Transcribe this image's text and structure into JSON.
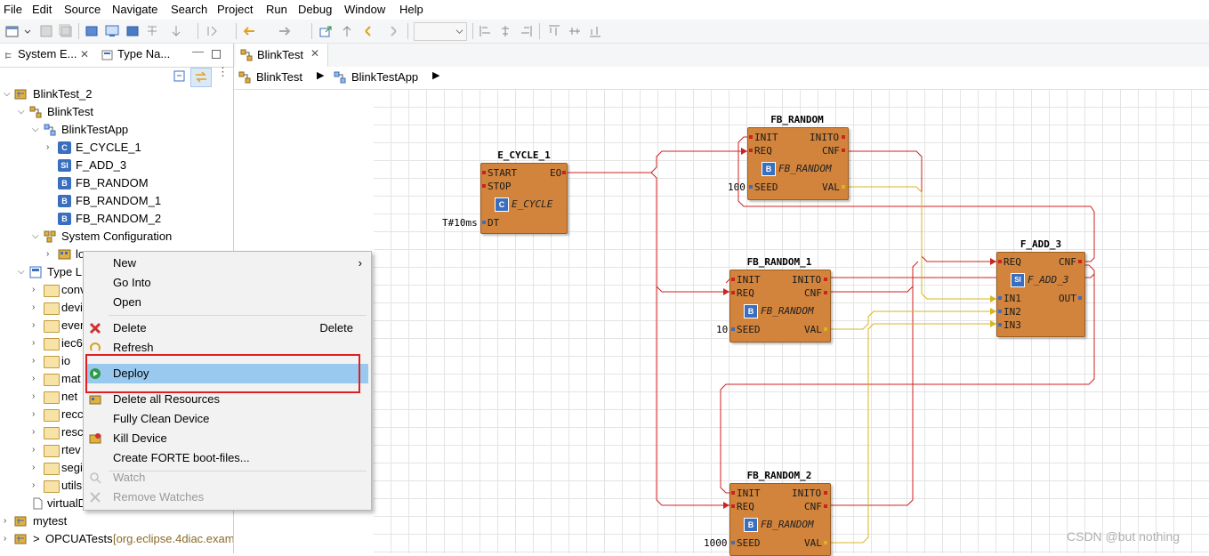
{
  "menubar": [
    "File",
    "Edit",
    "Source",
    "Navigate",
    "Search",
    "Project",
    "Run",
    "Debug",
    "Window",
    "Help"
  ],
  "left_tabs": {
    "system_explorer": "System E...",
    "type_navigator": "Type Na..."
  },
  "tree": {
    "root": "BlinkTest_2",
    "system": "BlinkTest",
    "app": "BlinkTestApp",
    "fbs": [
      "E_CYCLE_1",
      "F_ADD_3",
      "FB_RANDOM",
      "FB_RANDOM_1",
      "FB_RANDOM_2"
    ],
    "sys_config": "System Configuration",
    "device": "lo",
    "type_lib": "Type L",
    "folders": [
      "conv",
      "devi",
      "ever",
      "iec6",
      "io",
      "mat",
      "net",
      "recc",
      "resc",
      "rtev",
      "segi",
      "utils"
    ],
    "virtual": "virtualD",
    "mytest": "mytest",
    "opcua": "OPCUATests",
    "opcua_path": "[org.eclipse.4diac.exam"
  },
  "editor": {
    "tab": "BlinkTest",
    "breadcrumb": [
      "BlinkTest",
      "BlinkTestApp"
    ]
  },
  "blocks": {
    "e_cycle": {
      "name": "E_CYCLE_1",
      "type": "E_CYCLE",
      "inputs": [
        "START",
        "STOP"
      ],
      "outputs": [
        "EO"
      ],
      "data_in": [
        "DT"
      ],
      "dt_value": "T#10ms"
    },
    "fb_random": {
      "name": "FB_RANDOM",
      "type": "FB_RANDOM",
      "seed": "100"
    },
    "fb_random_1": {
      "name": "FB_RANDOM_1",
      "type": "FB_RANDOM",
      "seed": "10"
    },
    "fb_random_2": {
      "name": "FB_RANDOM_2",
      "type": "FB_RANDOM",
      "seed": "1000"
    },
    "f_add": {
      "name": "F_ADD_3",
      "type": "F_ADD_3",
      "inputs": [
        "REQ"
      ],
      "outputs": [
        "CNF"
      ],
      "data_in": [
        "IN1",
        "IN2",
        "IN3"
      ],
      "data_out": [
        "OUT"
      ]
    },
    "pins": {
      "init": "INIT",
      "req": "REQ",
      "inito": "INITO",
      "cnf": "CNF",
      "seed": "SEED",
      "val": "VAL"
    }
  },
  "context_menu": {
    "new": "New",
    "go_into": "Go Into",
    "open": "Open",
    "delete": "Delete",
    "delete_shortcut": "Delete",
    "refresh": "Refresh",
    "deploy": "Deploy",
    "delete_all": "Delete all Resources",
    "fully_clean": "Fully Clean Device",
    "kill": "Kill Device",
    "create_boot": "Create FORTE boot-files...",
    "watch": "Watch",
    "remove_watches": "Remove Watches"
  },
  "watermark": "CSDN @but nothing",
  "colors": {
    "event_line": "#cc2222",
    "data_line": "#d8b420",
    "fb_fill": "#d2843c",
    "highlight": "#99c9ef",
    "annotation_red": "#e02020"
  }
}
